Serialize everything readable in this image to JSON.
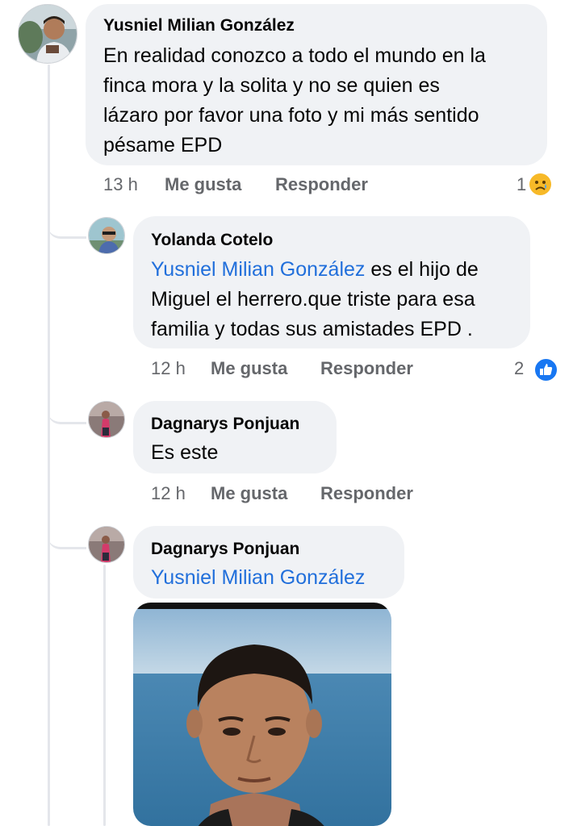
{
  "comments": [
    {
      "author": "Yusniel Milian González",
      "lines": [
        "En realidad conozco a todo el mundo en la",
        "finca mora y la solita y no se quien es",
        "lázaro por favor una foto y mi más sentido",
        "pésame EPD"
      ],
      "time": "13 h",
      "like_label": "Me gusta",
      "reply_label": "Responder",
      "reaction_count": "1",
      "reaction": "sad-reaction-icon"
    },
    {
      "author": "Yolanda Cotelo",
      "mention": "Yusniel Milian González",
      "line1_rest": " es el hijo de",
      "lines": [
        "Miguel el herrero.que triste para esa",
        "familia y todas sus amistades EPD ."
      ],
      "time": "12 h",
      "like_label": "Me gusta",
      "reply_label": "Responder",
      "reaction_count": "2",
      "reaction": "like-reaction-icon"
    },
    {
      "author": "Dagnarys Ponjuan",
      "text": "Es este",
      "time": "12 h",
      "like_label": "Me gusta",
      "reply_label": "Responder"
    },
    {
      "author": "Dagnarys Ponjuan",
      "mention": "Yusniel Milian González",
      "attachment": "photo-attachment"
    }
  ],
  "colors": {
    "bubble": "#f0f2f5",
    "mention": "#216fdb",
    "meta": "#65676b",
    "like_blue": "#1877f2",
    "sad_yellow": "#f7b928"
  }
}
